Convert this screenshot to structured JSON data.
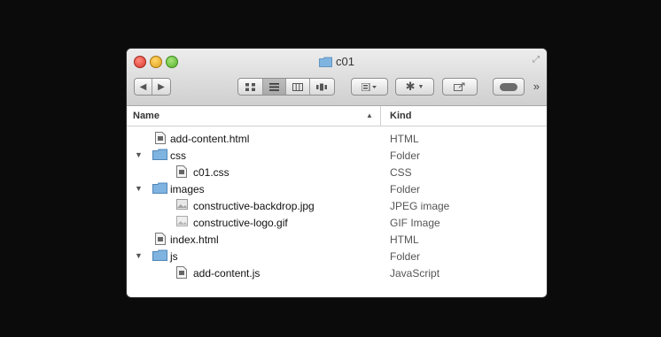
{
  "window": {
    "title": "c01"
  },
  "toolbar": {
    "back_label": "◀",
    "forward_label": "▶",
    "more_label": "»"
  },
  "columns": {
    "name": "Name",
    "kind": "Kind"
  },
  "rows": [
    {
      "name": "add-content.html",
      "kind": "HTML",
      "icon": "html-file-icon",
      "disclosure": ""
    },
    {
      "name": "css",
      "kind": "Folder",
      "icon": "folder-icon",
      "disclosure": "▼"
    },
    {
      "name": "c01.css",
      "kind": "CSS",
      "icon": "css-file-icon",
      "disclosure": ""
    },
    {
      "name": "images",
      "kind": "Folder",
      "icon": "folder-icon",
      "disclosure": "▼"
    },
    {
      "name": "constructive-backdrop.jpg",
      "kind": "JPEG image",
      "icon": "jpeg-file-icon",
      "disclosure": ""
    },
    {
      "name": "constructive-logo.gif",
      "kind": "GIF Image",
      "icon": "gif-file-icon",
      "disclosure": ""
    },
    {
      "name": "index.html",
      "kind": "HTML",
      "icon": "html-file-icon",
      "disclosure": ""
    },
    {
      "name": "js",
      "kind": "Folder",
      "icon": "folder-icon",
      "disclosure": "▼"
    },
    {
      "name": "add-content.js",
      "kind": "JavaScript",
      "icon": "js-file-icon",
      "disclosure": ""
    }
  ],
  "colors": {
    "folder": "#7fb3e0",
    "background": "#0b0b0b"
  }
}
